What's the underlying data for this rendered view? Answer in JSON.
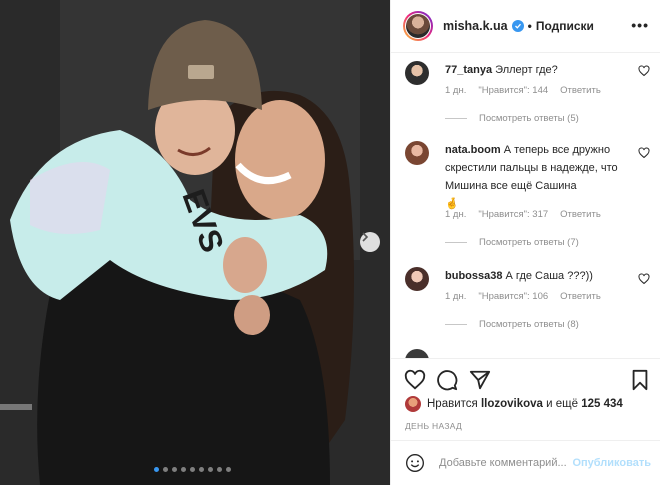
{
  "post": {
    "author": "misha.k.ua",
    "follow_separator": "•",
    "follow_label": "Подписки",
    "more_label": "•••",
    "carousel_total": 9,
    "carousel_active": 1
  },
  "comments": [
    {
      "user": "77_tanya",
      "text": "Эллерт где?",
      "time": "1 дн.",
      "likes": "\"Нравится\": 144",
      "reply": "Ответить",
      "view_replies": "Посмотреть ответы (5)"
    },
    {
      "user": "nata.boom",
      "text": "А теперь все дружно скрестили пальцы в надежде, что Мишина все ещё Сашина",
      "emoji": "🤞",
      "time": "1 дн.",
      "likes": "\"Нравится\": 317",
      "reply": "Ответить",
      "view_replies": "Посмотреть ответы (7)"
    },
    {
      "user": "bubossa38",
      "text": "А где Саша ???))",
      "time": "1 дн.",
      "likes": "\"Нравится\": 106",
      "reply": "Ответить",
      "view_replies": "Посмотреть ответы (8)"
    }
  ],
  "likes_line": {
    "prefix": "Нравится",
    "user": "llozovikova",
    "middle": "и ещё",
    "count": "125 434"
  },
  "date_label": "ДЕНЬ НАЗАД",
  "comment_box": {
    "placeholder": "Добавьте комментарий...",
    "publish_label": "Опубликовать"
  },
  "colors": {
    "accent": "#3897f0",
    "publish_disabled": "#b2dffc",
    "muted": "#8e8e8e"
  },
  "icons": [
    "chevron-right-icon",
    "verified-icon",
    "heart-icon",
    "comment-icon",
    "share-icon",
    "bookmark-icon",
    "emoji-icon"
  ]
}
